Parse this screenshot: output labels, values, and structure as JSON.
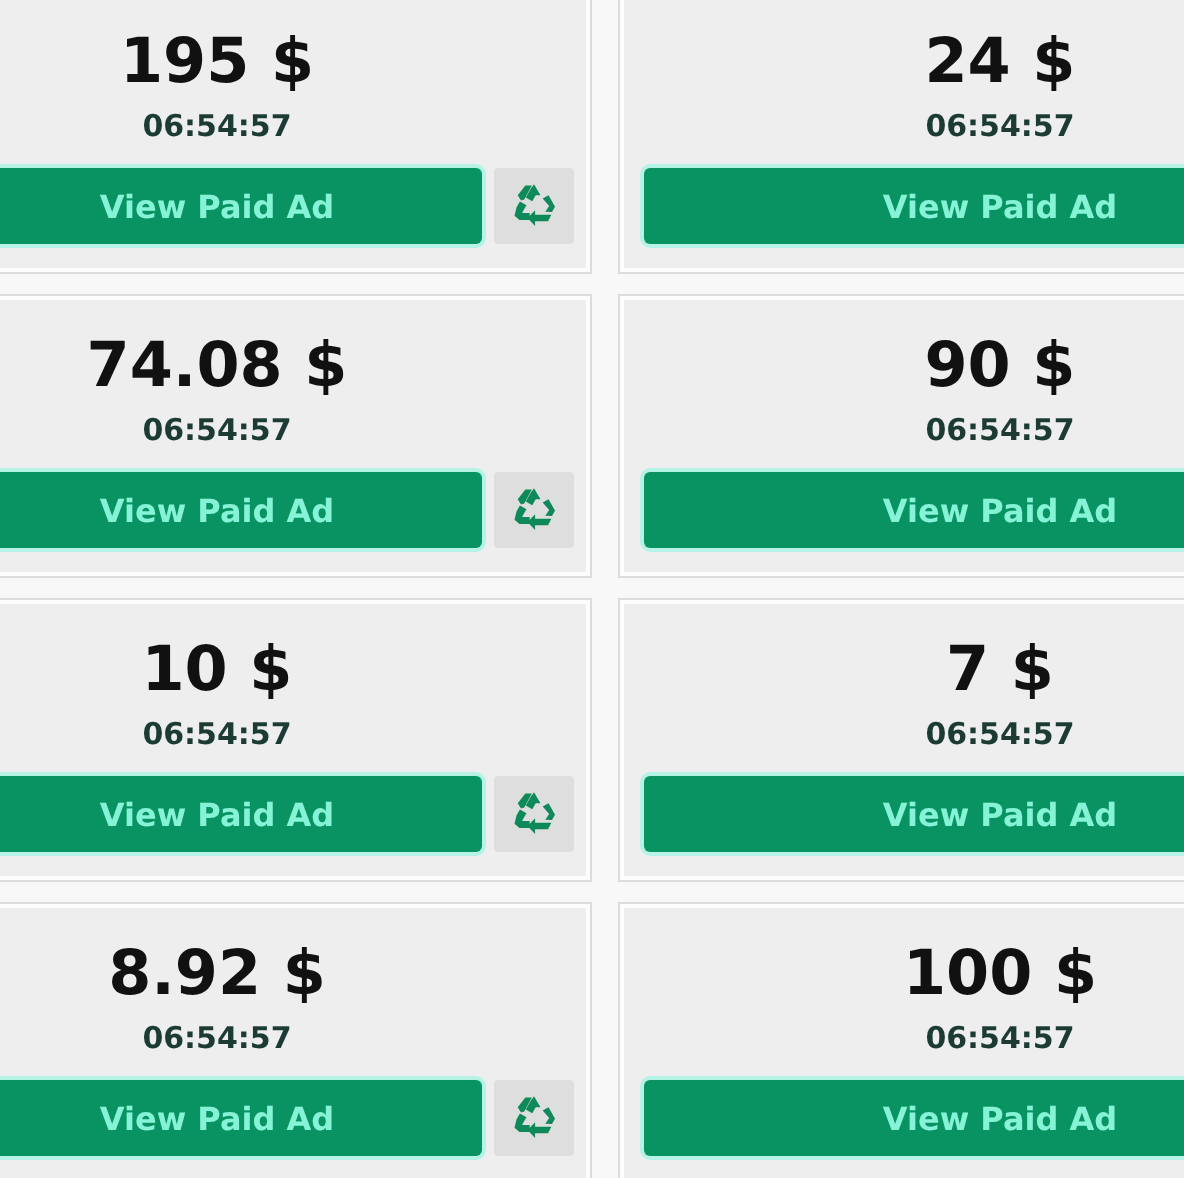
{
  "cards": [
    {
      "amount": "195 $",
      "time": "06:54:57",
      "button": "View Paid Ad",
      "recycle_button": true
    },
    {
      "amount": "24 $",
      "time": "06:54:57",
      "button": "View Paid Ad",
      "recycle_button": false
    },
    {
      "amount": "74.08 $",
      "time": "06:54:57",
      "button": "View Paid Ad",
      "recycle_button": true
    },
    {
      "amount": "90 $",
      "time": "06:54:57",
      "button": "View Paid Ad",
      "recycle_button": false
    },
    {
      "amount": "10 $",
      "time": "06:54:57",
      "button": "View Paid Ad",
      "recycle_button": true
    },
    {
      "amount": "7 $",
      "time": "06:54:57",
      "button": "View Paid Ad",
      "recycle_button": false
    },
    {
      "amount": "8.92 $",
      "time": "06:54:57",
      "button": "View Paid Ad",
      "recycle_button": true
    },
    {
      "amount": "100 $",
      "time": "06:54:57",
      "button": "View Paid Ad",
      "recycle_button": false
    }
  ]
}
